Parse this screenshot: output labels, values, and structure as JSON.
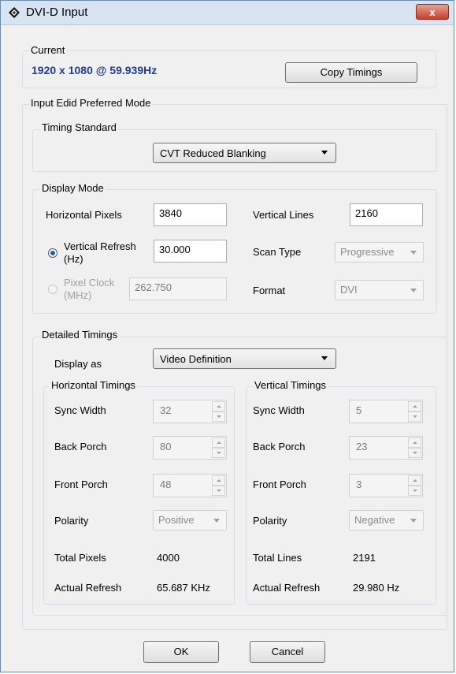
{
  "window": {
    "title": "DVI-D Input",
    "close_label": "x"
  },
  "current": {
    "group_label": "Current",
    "resolution": "1920 x 1080 @ 59.939Hz",
    "copy_button": "Copy Timings"
  },
  "edid": {
    "group_label": "Input Edid Preferred Mode",
    "timing_standard": {
      "group_label": "Timing Standard",
      "selected": "CVT Reduced Blanking"
    },
    "display_mode": {
      "group_label": "Display Mode",
      "h_pixels_label": "Horizontal Pixels",
      "h_pixels_value": "3840",
      "v_lines_label": "Vertical Lines",
      "v_lines_value": "2160",
      "v_refresh_label_1": "Vertical Refresh",
      "v_refresh_label_2": "(Hz)",
      "v_refresh_value": "30.000",
      "scan_type_label": "Scan Type",
      "scan_type_value": "Progressive",
      "pixel_clock_label_1": "Pixel Clock",
      "pixel_clock_label_2": "(MHz)",
      "pixel_clock_value": "262.750",
      "format_label": "Format",
      "format_value": "DVI"
    },
    "detailed": {
      "group_label": "Detailed Timings",
      "display_as_label": "Display as",
      "display_as_value": "Video Definition",
      "horizontal": {
        "group_label": "Horizontal Timings",
        "sync_width_label": "Sync Width",
        "sync_width": "32",
        "back_porch_label": "Back Porch",
        "back_porch": "80",
        "front_porch_label": "Front Porch",
        "front_porch": "48",
        "polarity_label": "Polarity",
        "polarity": "Positive",
        "total_label": "Total Pixels",
        "total": "4000",
        "refresh_label": "Actual Refresh",
        "refresh": "65.687 KHz"
      },
      "vertical": {
        "group_label": "Vertical Timings",
        "sync_width_label": "Sync Width",
        "sync_width": "5",
        "back_porch_label": "Back Porch",
        "back_porch": "23",
        "front_porch_label": "Front Porch",
        "front_porch": "3",
        "polarity_label": "Polarity",
        "polarity": "Negative",
        "total_label": "Total Lines",
        "total": "2191",
        "refresh_label": "Actual Refresh",
        "refresh": "29.980 Hz"
      }
    }
  },
  "footer": {
    "ok": "OK",
    "cancel": "Cancel"
  },
  "colors": {
    "accent_text": "#1c3d8f",
    "close_button": "#c7402a",
    "titlebar": "#d7e4f2"
  },
  "icons": {
    "app": "diamond-app-icon",
    "close": "close-icon"
  }
}
